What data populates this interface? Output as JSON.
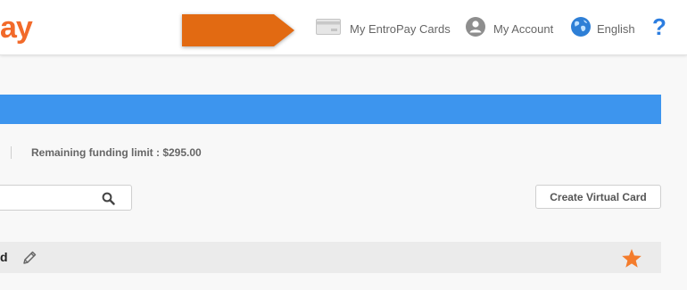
{
  "header": {
    "logo_text": "ay",
    "nav": {
      "cards_label": "My EntroPay Cards",
      "account_label": "My Account",
      "language_label": "English",
      "help_label": "?"
    },
    "icons": {
      "cards": "credit-card-icon",
      "account": "user-circle-icon",
      "language": "globe-icon",
      "callout": "orange-arrow-callout"
    }
  },
  "summary": {
    "funding_limit_text": "Remaining funding limit : $295.00"
  },
  "search": {
    "value": "",
    "placeholder": "",
    "icon": "search-icon"
  },
  "actions": {
    "create_virtual_card_label": "Create Virtual Card"
  },
  "card_row": {
    "name_fragment": "d",
    "edit_icon": "pencil-icon",
    "favorite_icon": "star-icon"
  },
  "colors": {
    "brand_orange": "#f26a2a",
    "arrow_orange": "#e26a12",
    "accent_blue": "#3d95ee",
    "help_blue": "#2b7de0",
    "star_orange": "#f47c2c"
  }
}
